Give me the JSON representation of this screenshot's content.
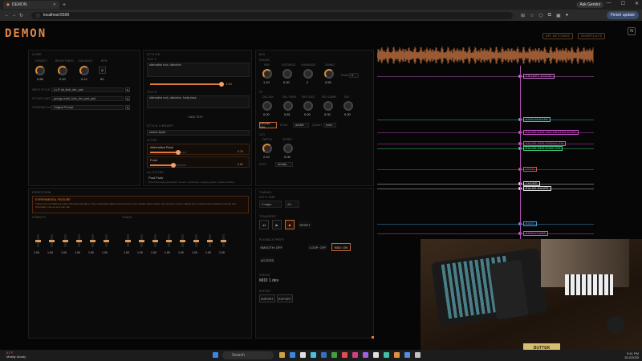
{
  "browser": {
    "tab_title": "DEMON",
    "url": "localhost:5500",
    "gemini_label": "Ask Gemini",
    "update_label": "Finish update"
  },
  "app": {
    "logo": "DEMON",
    "top_buttons": [
      "API SETTINGS",
      "SHORTCUTS"
    ],
    "icon_label": "N"
  },
  "core": {
    "title": "CORE",
    "knobs": [
      {
        "label": "DENSITY",
        "value": "0.85"
      },
      {
        "label": "BRIGHTNESS",
        "value": "0.20"
      },
      {
        "label": "GUIDANCE",
        "value": "0.12"
      },
      {
        "label": "BPM",
        "value": "92"
      }
    ],
    "fields": [
      {
        "label": "INPUT STYLE",
        "value": "Lo-Fi alt_funk_dec_pad"
      },
      {
        "label": "STYLES HINT",
        "value": "grungy, trash_funk_dec_pad_pad"
      },
      {
        "label": "STEERING MIX",
        "value": "Original Prompt"
      }
    ]
  },
  "styles": {
    "title": "STYLES",
    "text_a": {
      "label": "TEXT A",
      "value": "alternative rock, distortion"
    },
    "text_b": {
      "label": "TEXT B",
      "value": "alternative rock, distortion, funky bass"
    },
    "slider_value": "1.00",
    "add_text": "+ ADD TEXT",
    "library_title": "STYLE LIBRARY",
    "search_placeholder": "search styles",
    "active_label": "ACTIVE",
    "active": [
      {
        "name": "Alternative Rock",
        "value": "0.76"
      },
      {
        "name": "Funk",
        "value": "0.62"
      }
    ],
    "all_title": "ALL STYLES",
    "all_item": "Post Punk",
    "all_desc": "Post-Punk style generation: Covers, percussive, angular guitars, insistent driving"
  },
  "mix": {
    "title": "MIX",
    "drums_title": "DRUMS",
    "drum_knobs": [
      {
        "label": "PAN",
        "value": "1.10"
      },
      {
        "label": "DISTANCE",
        "value": "0.00"
      },
      {
        "label": "HUMANIZE",
        "value": "2"
      },
      {
        "label": "SWING",
        "value": "0.50"
      }
    ],
    "range_label": "RANGE",
    "range_value": "0",
    "fx_title": "FX",
    "fx_knobs": [
      {
        "label": "DEL MIX",
        "value": "0.00"
      },
      {
        "label": "DEL FDBK",
        "value": "0.81"
      },
      {
        "label": "REV SIZE",
        "value": "0.00"
      },
      {
        "label": "REV DAMP",
        "value": "0.00"
      },
      {
        "label": "SAT",
        "value": "0.00"
      }
    ],
    "toggle": "DRUM: ON",
    "swing_label": "SYNC",
    "swing_value": "double",
    "quantize_label": "QUANT",
    "quantize_value": "none",
    "lfo_title": "LFO",
    "lfo_knobs": [
      {
        "label": "DEPTH",
        "value": "2.10"
      },
      {
        "label": "SPEED",
        "value": "0.00"
      }
    ],
    "lfo_target_label": "DEST",
    "lfo_target_value": "density"
  },
  "freeform": {
    "title": "FREEFORM",
    "alert_title": "EXPERIMENTAL FEATURE",
    "alert_body": "These are not traditional audio channels and gates. They manipulate different dimensions of the model's latent space, and produce results ranging from nuanced and beautiful to abrupt and discordant. Use at your own risk.",
    "col1_title": "STABILITY",
    "col2_title": "CHAOS",
    "channels_1": [
      "1.00",
      "1.00",
      "1.00",
      "1.00",
      "1.00",
      "1.00"
    ],
    "channels_2": [
      "1.00",
      "1.00",
      "1.00",
      "1.00",
      "1.00",
      "1.00",
      "1.00",
      "1.00"
    ]
  },
  "timing": {
    "title": "TIMING",
    "key_title": "KEY & TIME",
    "key_value": "C major",
    "bpm_value": "4/4",
    "transport_title": "TRANSPORT",
    "transport_buttons": [
      "◂◂",
      "▶",
      "■",
      "RESET"
    ],
    "playback_title": "PLAYBACK PREFS",
    "smooth": "SMOOTH: OFF",
    "loop": "LOOP: OFF",
    "kbd": "KBD: ON",
    "access": "ACCESS",
    "status_title": "STATUS",
    "status_value": "MIDI 1 dev",
    "export_title": "EXPORT",
    "export_buttons": [
      "IMPORT",
      "EXPORT"
    ]
  },
  "tracks": [
    {
      "label": "PROMPT SCENE",
      "color": "#d070d0"
    },
    {
      "label": "ATMOSPHERE",
      "color": "#40c0c0"
    },
    {
      "label": "PULSE GEN ORCHESTRA FUNK",
      "color": "#d050d0"
    },
    {
      "label": "PULSE GEN SIGNAL FM",
      "color": "#d050d0"
    },
    {
      "label": "PULSE GEN FUNK FM",
      "color": "#40d080"
    },
    {
      "label": "LEAD",
      "color": "#e05050"
    },
    {
      "label": "CHORD",
      "color": "#e0e0e0"
    },
    {
      "label": "PULSE SHAPE",
      "color": "#e0e0e0"
    },
    {
      "label": "BASS",
      "color": "#40a0e0"
    },
    {
      "label": "STRUCTURE",
      "color": "#d050d0"
    }
  ],
  "overlay": {
    "sticker": "BUTTER"
  },
  "taskbar": {
    "weather_temp": "61°F",
    "weather_desc": "Mostly cloudy",
    "search": "Search",
    "time": "9:41 PM",
    "date": "3/12/2025"
  }
}
